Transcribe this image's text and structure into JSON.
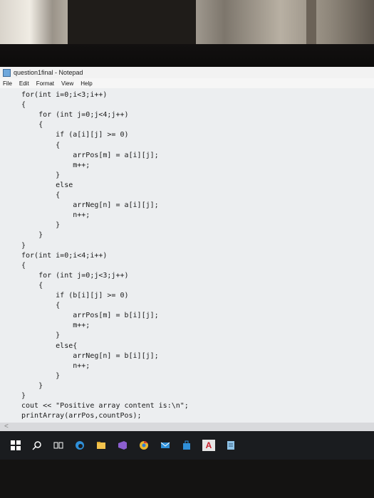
{
  "window": {
    "title": "question1final - Notepad"
  },
  "menu": [
    "File",
    "Edit",
    "Format",
    "View",
    "Help"
  ],
  "code": [
    "for(int i=0;i<3;i++)",
    "{",
    "    for (int j=0;j<4;j++)",
    "    {",
    "        if (a[i][j] >= 0)",
    "        {",
    "            arrPos[m] = a[i][j];",
    "            m++;",
    "        }",
    "        else",
    "        {",
    "            arrNeg[n] = a[i][j];",
    "            n++;",
    "        }",
    "    }",
    "}",
    "for(int i=0;i<4;i++)",
    "{",
    "    for (int j=0;j<3;j++)",
    "    {",
    "        if (b[i][j] >= 0)",
    "        {",
    "            arrPos[m] = b[i][j];",
    "            m++;",
    "        }",
    "        else{",
    "            arrNeg[n] = b[i][j];",
    "            n++;",
    "        }",
    "    }",
    "}",
    "cout << \"Positive array content is:\\n\";",
    "printArray(arrPos,countPos);"
  ],
  "taskbar": {
    "items": [
      "windows-start",
      "search",
      "task-view",
      "edge",
      "file-explorer",
      "visual-studio",
      "chrome",
      "mail",
      "store",
      "acrobat",
      "notepad"
    ],
    "acrobat_label": "A"
  },
  "colors": {
    "taskbar": "#1a1c1f",
    "editor_bg": "#eceef0"
  }
}
